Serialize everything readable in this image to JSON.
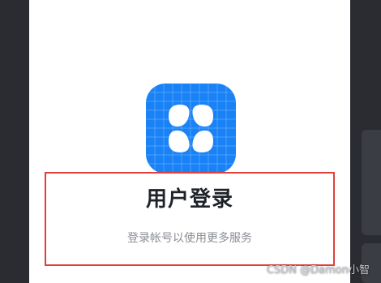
{
  "login": {
    "title": "用户登录",
    "subtitle": "登录帐号以使用更多服务"
  },
  "icon": {
    "name": "app-logo-icon",
    "background": "#1a82f7",
    "foreground": "#ffffff"
  },
  "annotation": {
    "highlight_color": "#e0403c"
  },
  "watermark": {
    "text": "CSDN @Damon小智"
  }
}
